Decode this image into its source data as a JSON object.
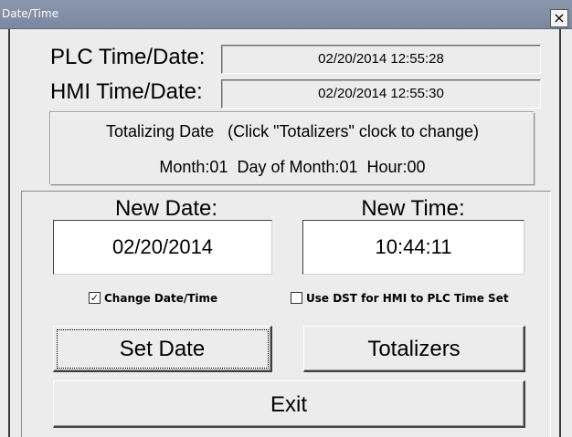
{
  "window": {
    "title": "Date/Time",
    "close_glyph": "×"
  },
  "plc": {
    "label": "PLC Time/Date:",
    "value": "02/20/2014 12:55:28"
  },
  "hmi": {
    "label": "HMI Time/Date:",
    "value": "02/20/2014 12:55:30"
  },
  "totalizing": {
    "line1": "Totalizing Date   (Click \"Totalizers\" clock to change)",
    "line2": "Month:01  Day of Month:01  Hour:00"
  },
  "new_date": {
    "label": "New Date:",
    "value": "02/20/2014"
  },
  "new_time": {
    "label": "New Time:",
    "value": "10:44:11"
  },
  "options": {
    "change_datetime": {
      "label": "Change Date/Time",
      "checked": true,
      "mark": "✓"
    },
    "use_dst": {
      "label": "Use DST for HMI to PLC Time Set",
      "checked": false,
      "mark": ""
    }
  },
  "buttons": {
    "set_date": "Set Date",
    "totalizers": "Totalizers",
    "exit": "Exit"
  }
}
